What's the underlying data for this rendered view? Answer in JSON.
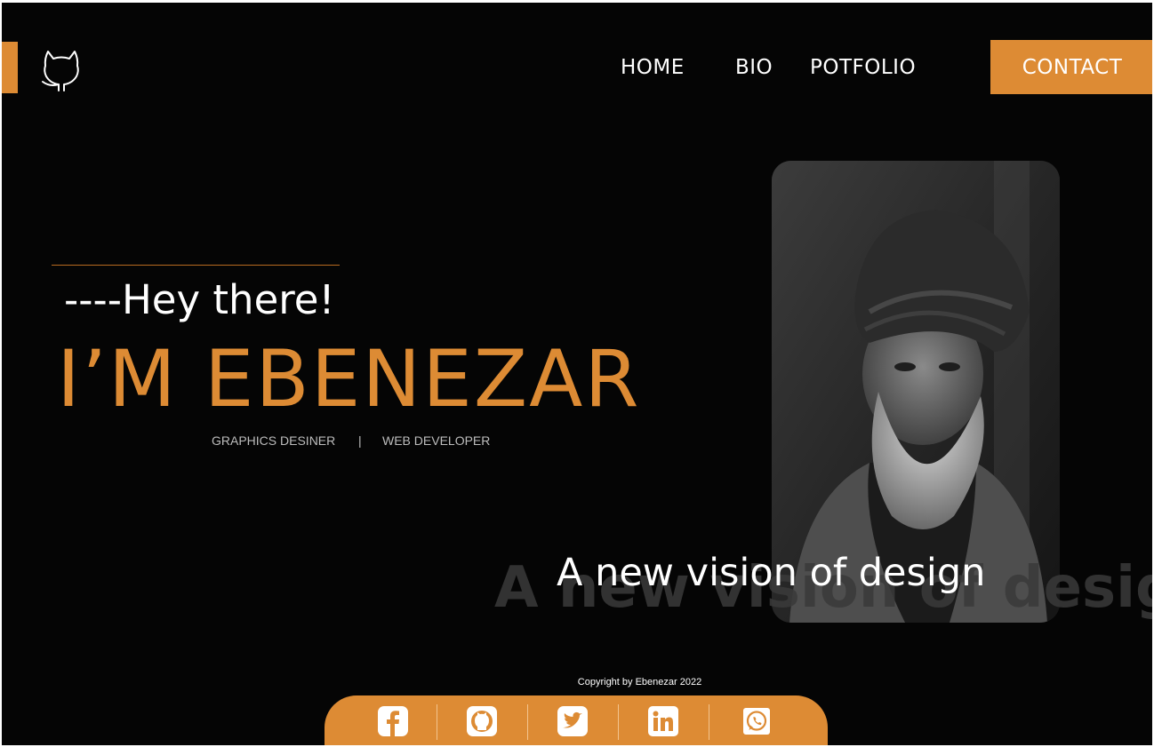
{
  "nav": {
    "home": "HOME",
    "bio": "BIO",
    "portfolio": "POTFOLIO",
    "contact": "CONTACT"
  },
  "hero": {
    "greeting": "----Hey there!",
    "name": "I’M EBENEZAR",
    "role_1": "GRAPHICS DESINER",
    "separator": "|",
    "role_2": "WEB DEVELOPER",
    "tagline": "A new vision of design",
    "tagline_ghost": "A new vision of design"
  },
  "footer": {
    "copyright": "Copyright by Ebenezar 2022",
    "social": [
      "facebook-icon",
      "github-icon",
      "twitter-icon",
      "linkedin-icon",
      "whatsapp-icon"
    ]
  },
  "colors": {
    "accent": "#dd8b34",
    "background": "#050505",
    "text": "#ffffff"
  }
}
